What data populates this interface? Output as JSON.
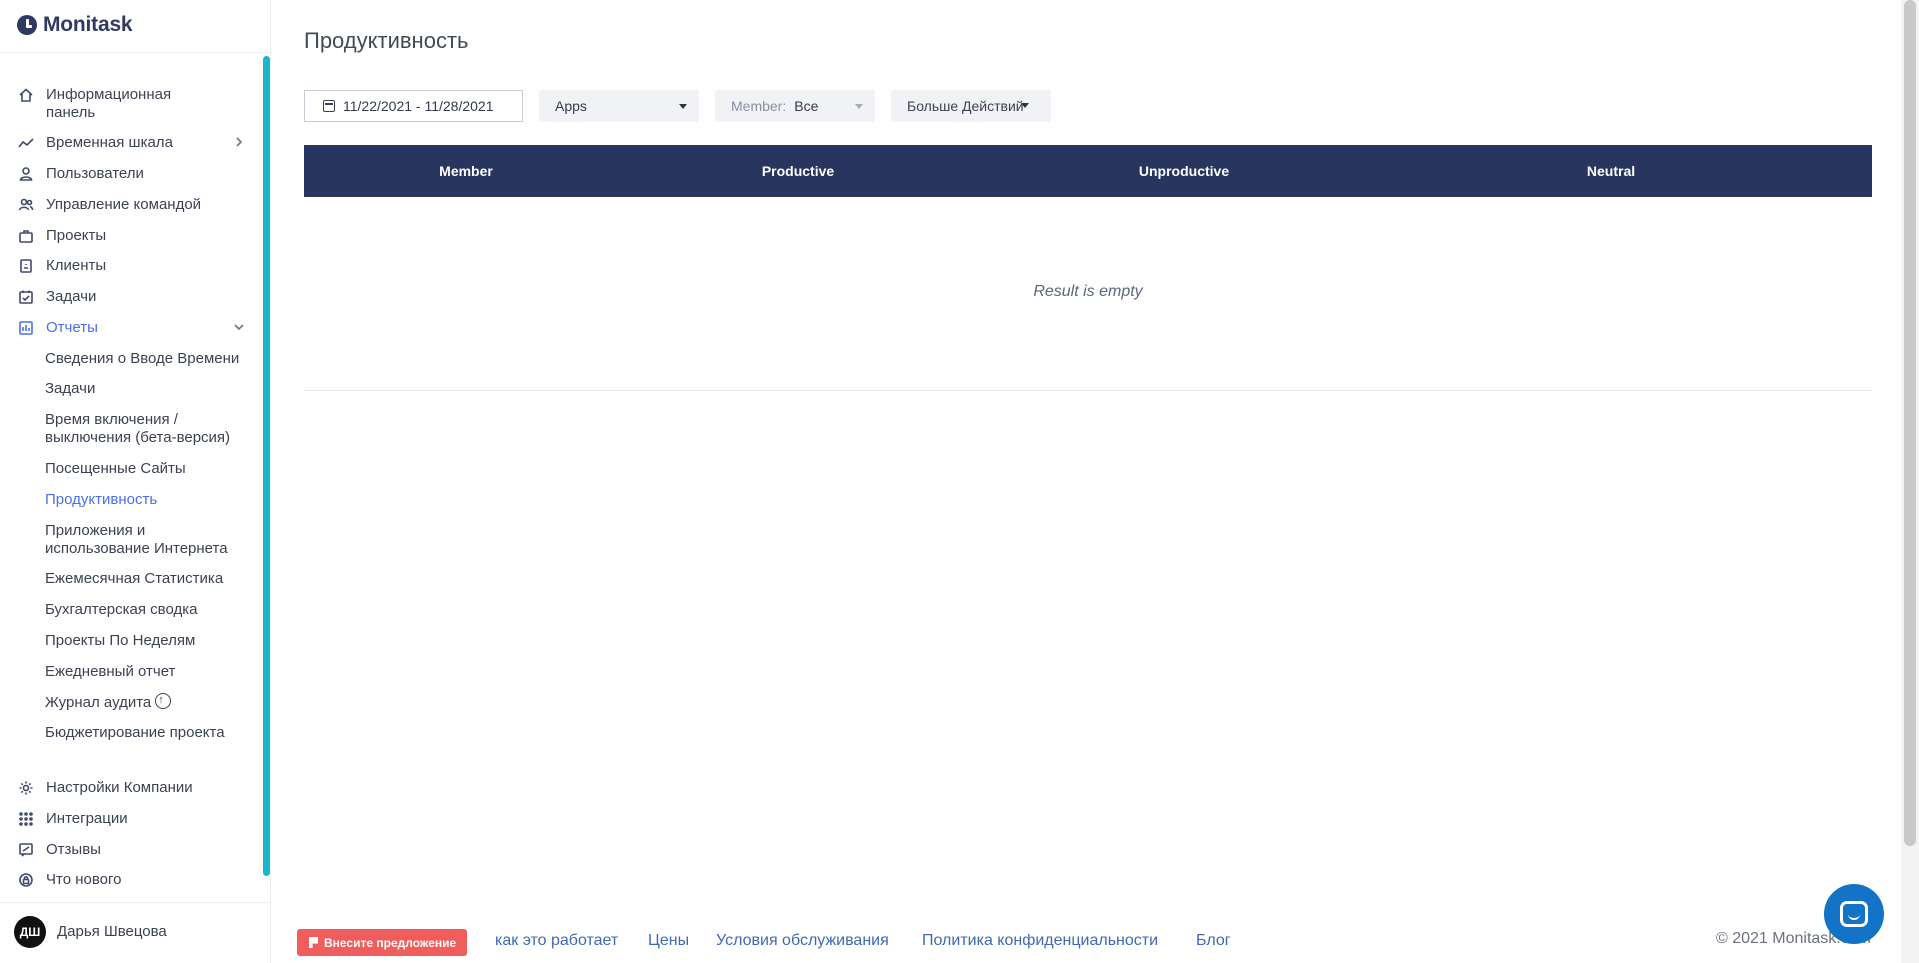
{
  "app": {
    "name": "Monitask"
  },
  "sidebar": {
    "items": [
      {
        "label": "Информационная панель",
        "icon": "home-icon"
      },
      {
        "label": "Временная шкала",
        "icon": "timeline-icon"
      },
      {
        "label": "Пользователи",
        "icon": "user-icon"
      },
      {
        "label": "Управление командой",
        "icon": "team-icon"
      },
      {
        "label": "Проекты",
        "icon": "briefcase-icon"
      },
      {
        "label": "Клиенты",
        "icon": "clients-icon"
      },
      {
        "label": "Задачи",
        "icon": "tasks-icon"
      },
      {
        "label": "Отчеты",
        "icon": "reports-icon"
      }
    ],
    "reports_sub": [
      "Сведения о Вводе Времени",
      "Задачи",
      "Время включения / выключения (бета-версия)",
      "Посещенные Сайты",
      "Продуктивность",
      "Приложения и использование Интернета",
      "Ежемесячная Статистика",
      "Бухгалтерская сводка",
      "Проекты По Неделям",
      "Ежедневный отчет",
      "Журнал аудита",
      "Бюджетирование проекта"
    ],
    "bottom_items": [
      {
        "label": "Настройки Компании",
        "icon": "gear-icon"
      },
      {
        "label": "Интеграции",
        "icon": "grid-icon"
      },
      {
        "label": "Отзывы",
        "icon": "feedback-icon"
      },
      {
        "label": "Что нового",
        "icon": "lock-icon"
      }
    ],
    "user": {
      "initials": "ДШ",
      "name": "Дарья Швецова"
    }
  },
  "page": {
    "title": "Продуктивность"
  },
  "filters": {
    "date_range": "11/22/2021 - 11/28/2021",
    "type": "Apps",
    "member_label": "Member:",
    "member_value": "Все",
    "more_actions": "Больше Действий"
  },
  "table": {
    "columns": [
      "Member",
      "Productive",
      "Unproductive",
      "Neutral"
    ],
    "empty_text": "Result is empty"
  },
  "footer": {
    "feedback_button": "Внесите предложение",
    "links": [
      "как это работает",
      "Цены",
      "Условия обслуживания",
      "Политика конфиденциальности",
      "Блог"
    ],
    "copyright": "© 2021 Monitask.com"
  },
  "colors": {
    "accent": "#4a6fe8",
    "table_header": "#27355f",
    "scroll_accent": "#1ab7cc",
    "feedback": "#ef5d5d",
    "chat": "#1273c7"
  }
}
